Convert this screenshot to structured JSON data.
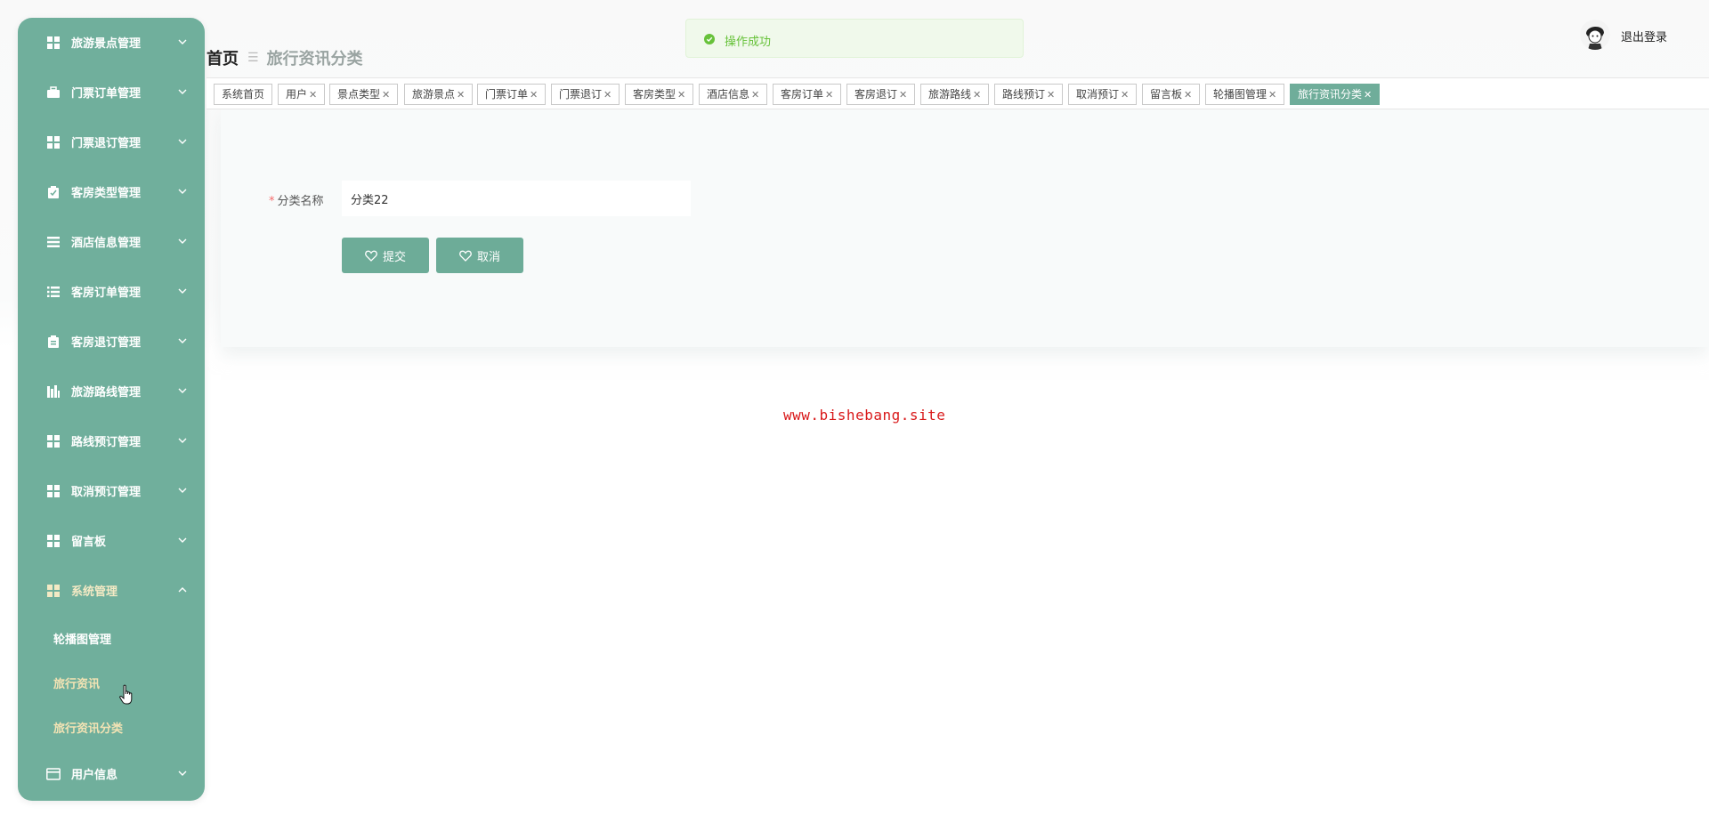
{
  "sidebar": {
    "items": [
      {
        "label": "旅游景点管理",
        "icon": "grid-icon"
      },
      {
        "label": "门票订单管理",
        "icon": "briefcase-icon"
      },
      {
        "label": "门票退订管理",
        "icon": "grid-icon"
      },
      {
        "label": "客房类型管理",
        "icon": "clipboard-icon"
      },
      {
        "label": "酒店信息管理",
        "icon": "list-icon"
      },
      {
        "label": "客房订单管理",
        "icon": "list-icon"
      },
      {
        "label": "客房退订管理",
        "icon": "clipboard-icon"
      },
      {
        "label": "旅游路线管理",
        "icon": "chart-icon"
      },
      {
        "label": "路线预订管理",
        "icon": "grid-icon"
      },
      {
        "label": "取消预订管理",
        "icon": "grid-icon"
      },
      {
        "label": "留言板",
        "icon": "grid-icon"
      },
      {
        "label": "系统管理",
        "icon": "grid-icon"
      },
      {
        "label": "用户信息",
        "icon": "card-icon"
      }
    ],
    "submenu": [
      {
        "label": "轮播图管理"
      },
      {
        "label": "旅行资讯"
      },
      {
        "label": "旅行资讯分类"
      }
    ]
  },
  "breadcrumb": {
    "home": "首页",
    "separator": "☰",
    "current": "旅行资讯分类"
  },
  "header": {
    "logout_label": "退出登录"
  },
  "toast": {
    "message": "操作成功"
  },
  "tags": [
    {
      "label": "系统首页",
      "closable": false
    },
    {
      "label": "用户",
      "closable": true
    },
    {
      "label": "景点类型",
      "closable": true
    },
    {
      "label": "旅游景点",
      "closable": true
    },
    {
      "label": "门票订单",
      "closable": true
    },
    {
      "label": "门票退订",
      "closable": true
    },
    {
      "label": "客房类型",
      "closable": true
    },
    {
      "label": "酒店信息",
      "closable": true
    },
    {
      "label": "客房订单",
      "closable": true
    },
    {
      "label": "客房退订",
      "closable": true
    },
    {
      "label": "旅游路线",
      "closable": true
    },
    {
      "label": "路线预订",
      "closable": true
    },
    {
      "label": "取消预订",
      "closable": true
    },
    {
      "label": "留言板",
      "closable": true
    },
    {
      "label": "轮播图管理",
      "closable": true
    },
    {
      "label": "旅行资讯分类",
      "closable": true,
      "active": true
    }
  ],
  "form": {
    "required_mark": "*",
    "category_label": "分类名称",
    "category_value": "分类22",
    "submit_label": "提交",
    "cancel_label": "取消"
  },
  "watermark": "www.bishebang.site",
  "colors": {
    "sidebar": "#70af9c",
    "accent": "#6dac98",
    "toast_bg": "#f0f9eb",
    "toast_text": "#67c23a",
    "required": "#f56c6c"
  }
}
